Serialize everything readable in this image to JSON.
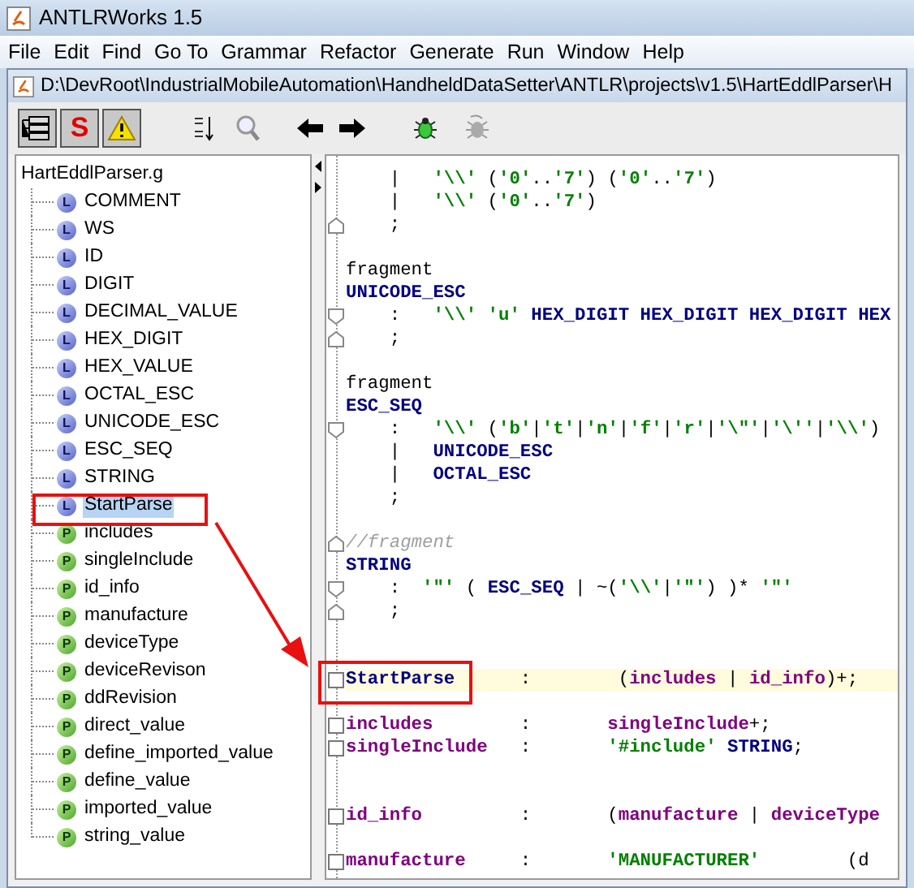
{
  "window": {
    "title": "ANTLRWorks 1.5"
  },
  "menu": [
    "File",
    "Edit",
    "Find",
    "Go To",
    "Grammar",
    "Refactor",
    "Generate",
    "Run",
    "Window",
    "Help"
  ],
  "document": {
    "title": "D:\\DevRoot\\IndustrialMobileAutomation\\HandheldDataSetter\\ANTLR\\projects\\v1.5\\HartEddlParser\\H"
  },
  "toolbar": [
    {
      "kind": "tree"
    },
    {
      "kind": "text",
      "label": "S"
    },
    {
      "kind": "warning"
    },
    {
      "kind": "sort"
    },
    {
      "kind": "find"
    },
    {
      "kind": "back"
    },
    {
      "kind": "forward"
    },
    {
      "kind": "debug"
    },
    {
      "kind": "debug_off"
    }
  ],
  "tree": {
    "root": "HartEddlParser.g",
    "items": [
      {
        "badge": "L",
        "label": "COMMENT",
        "selected": false
      },
      {
        "badge": "L",
        "label": "WS",
        "selected": false
      },
      {
        "badge": "L",
        "label": "ID",
        "selected": false
      },
      {
        "badge": "L",
        "label": "DIGIT",
        "selected": false
      },
      {
        "badge": "L",
        "label": "DECIMAL_VALUE",
        "selected": false
      },
      {
        "badge": "L",
        "label": "HEX_DIGIT",
        "selected": false
      },
      {
        "badge": "L",
        "label": "HEX_VALUE",
        "selected": false
      },
      {
        "badge": "L",
        "label": "OCTAL_ESC",
        "selected": false
      },
      {
        "badge": "L",
        "label": "UNICODE_ESC",
        "selected": false
      },
      {
        "badge": "L",
        "label": "ESC_SEQ",
        "selected": false
      },
      {
        "badge": "L",
        "label": "STRING",
        "selected": false
      },
      {
        "badge": "L",
        "label": "StartParse",
        "selected": true
      },
      {
        "badge": "P",
        "label": "includes",
        "selected": false
      },
      {
        "badge": "P",
        "label": "singleInclude",
        "selected": false
      },
      {
        "badge": "P",
        "label": "id_info",
        "selected": false
      },
      {
        "badge": "P",
        "label": "manufacture",
        "selected": false
      },
      {
        "badge": "P",
        "label": "deviceType",
        "selected": false
      },
      {
        "badge": "P",
        "label": "deviceRevison",
        "selected": false
      },
      {
        "badge": "P",
        "label": "ddRevision",
        "selected": false
      },
      {
        "badge": "P",
        "label": "direct_value",
        "selected": false
      },
      {
        "badge": "P",
        "label": "define_imported_value",
        "selected": false
      },
      {
        "badge": "P",
        "label": "define_value",
        "selected": false
      },
      {
        "badge": "P",
        "label": "imported_value",
        "selected": false
      },
      {
        "badge": "P",
        "label": "string_value",
        "selected": false
      }
    ]
  },
  "editor": {
    "lines": [
      {
        "kind": "line",
        "highlighted": false,
        "parts": [
          {
            "kind": "plain",
            "text": "    |   "
          },
          {
            "kind": "literal",
            "text": "'\\\\'"
          },
          {
            "kind": "plain",
            "text": " ("
          },
          {
            "kind": "literal",
            "text": "'0'"
          },
          {
            "kind": "plain",
            "text": ".."
          },
          {
            "kind": "literal",
            "text": "'7'"
          },
          {
            "kind": "plain",
            "text": ") ("
          },
          {
            "kind": "literal",
            "text": "'0'"
          },
          {
            "kind": "plain",
            "text": ".."
          },
          {
            "kind": "literal",
            "text": "'7'"
          },
          {
            "kind": "plain",
            "text": ")"
          }
        ]
      },
      {
        "kind": "line",
        "highlighted": false,
        "parts": [
          {
            "kind": "plain",
            "text": "    |   "
          },
          {
            "kind": "literal",
            "text": "'\\\\'"
          },
          {
            "kind": "plain",
            "text": " ("
          },
          {
            "kind": "literal",
            "text": "'0'"
          },
          {
            "kind": "plain",
            "text": ".."
          },
          {
            "kind": "literal",
            "text": "'7'"
          },
          {
            "kind": "plain",
            "text": ")"
          }
        ]
      },
      {
        "kind": "fold_close",
        "highlighted": false,
        "parts": [
          {
            "kind": "plain",
            "text": "    ;"
          }
        ]
      },
      {
        "kind": "blank"
      },
      {
        "kind": "line",
        "highlighted": false,
        "parts": [
          {
            "kind": "plain",
            "text": "fragment"
          }
        ]
      },
      {
        "kind": "line",
        "highlighted": false,
        "parts": [
          {
            "kind": "token",
            "text": "UNICODE_ESC"
          }
        ]
      },
      {
        "kind": "fold_open",
        "highlighted": false,
        "parts": [
          {
            "kind": "plain",
            "text": "    :   "
          },
          {
            "kind": "literal",
            "text": "'\\\\' 'u' "
          },
          {
            "kind": "token",
            "text": "HEX_DIGIT HEX_DIGIT HEX_DIGIT HEX"
          }
        ]
      },
      {
        "kind": "fold_close",
        "highlighted": false,
        "parts": [
          {
            "kind": "plain",
            "text": "    ;"
          }
        ]
      },
      {
        "kind": "blank"
      },
      {
        "kind": "line",
        "highlighted": false,
        "parts": [
          {
            "kind": "plain",
            "text": "fragment"
          }
        ]
      },
      {
        "kind": "line",
        "highlighted": false,
        "parts": [
          {
            "kind": "token",
            "text": "ESC_SEQ"
          }
        ]
      },
      {
        "kind": "fold_open",
        "highlighted": false,
        "parts": [
          {
            "kind": "plain",
            "text": "    :   "
          },
          {
            "kind": "literal",
            "text": "'\\\\'"
          },
          {
            "kind": "plain",
            "text": " ("
          },
          {
            "kind": "literal",
            "text": "'b'"
          },
          {
            "kind": "plain",
            "text": "|"
          },
          {
            "kind": "literal",
            "text": "'t'"
          },
          {
            "kind": "plain",
            "text": "|"
          },
          {
            "kind": "literal",
            "text": "'n'"
          },
          {
            "kind": "plain",
            "text": "|"
          },
          {
            "kind": "literal",
            "text": "'f'"
          },
          {
            "kind": "plain",
            "text": "|"
          },
          {
            "kind": "literal",
            "text": "'r'"
          },
          {
            "kind": "plain",
            "text": "|"
          },
          {
            "kind": "literal",
            "text": "'\\\"'"
          },
          {
            "kind": "plain",
            "text": "|"
          },
          {
            "kind": "literal",
            "text": "'\\''"
          },
          {
            "kind": "plain",
            "text": "|"
          },
          {
            "kind": "literal",
            "text": "'\\\\'"
          },
          {
            "kind": "plain",
            "text": ")"
          }
        ]
      },
      {
        "kind": "line",
        "highlighted": false,
        "parts": [
          {
            "kind": "plain",
            "text": "    |   "
          },
          {
            "kind": "token",
            "text": "UNICODE_ESC"
          }
        ]
      },
      {
        "kind": "line",
        "highlighted": false,
        "parts": [
          {
            "kind": "plain",
            "text": "    |   "
          },
          {
            "kind": "token",
            "text": "OCTAL_ESC"
          }
        ]
      },
      {
        "kind": "line",
        "highlighted": false,
        "parts": [
          {
            "kind": "plain",
            "text": "    ;"
          }
        ]
      },
      {
        "kind": "blank"
      },
      {
        "kind": "fold_close",
        "highlighted": false,
        "parts": [
          {
            "kind": "comment",
            "text": "//fragment"
          }
        ]
      },
      {
        "kind": "line",
        "highlighted": false,
        "parts": [
          {
            "kind": "token",
            "text": "STRING"
          }
        ]
      },
      {
        "kind": "fold_open",
        "highlighted": false,
        "parts": [
          {
            "kind": "plain",
            "text": "    :  "
          },
          {
            "kind": "literal",
            "text": "'\"'"
          },
          {
            "kind": "plain",
            "text": " ( "
          },
          {
            "kind": "token",
            "text": "ESC_SEQ"
          },
          {
            "kind": "plain",
            "text": " | ~("
          },
          {
            "kind": "literal",
            "text": "'\\\\'"
          },
          {
            "kind": "plain",
            "text": "|"
          },
          {
            "kind": "literal",
            "text": "'\"'"
          },
          {
            "kind": "plain",
            "text": ") )* "
          },
          {
            "kind": "literal",
            "text": "'\"'"
          }
        ]
      },
      {
        "kind": "fold_close",
        "highlighted": false,
        "parts": [
          {
            "kind": "plain",
            "text": "    ;"
          }
        ]
      },
      {
        "kind": "blank"
      },
      {
        "kind": "blank"
      },
      {
        "kind": "rule_box",
        "highlighted": true,
        "parts": [
          {
            "kind": "token",
            "text": "StartParse"
          },
          {
            "kind": "plain",
            "text": "      :        ("
          },
          {
            "kind": "rule",
            "text": "includes"
          },
          {
            "kind": "plain",
            "text": " | "
          },
          {
            "kind": "rule",
            "text": "id_info"
          },
          {
            "kind": "plain",
            "text": ")+;"
          }
        ]
      },
      {
        "kind": "blank"
      },
      {
        "kind": "rule_box",
        "highlighted": false,
        "parts": [
          {
            "kind": "rule",
            "text": "includes"
          },
          {
            "kind": "plain",
            "text": "        :       "
          },
          {
            "kind": "rule",
            "text": "singleInclude"
          },
          {
            "kind": "plain",
            "text": "+;"
          }
        ]
      },
      {
        "kind": "rule_box",
        "highlighted": false,
        "parts": [
          {
            "kind": "rule",
            "text": "singleInclude"
          },
          {
            "kind": "plain",
            "text": "   :       "
          },
          {
            "kind": "literal",
            "text": "'#include' "
          },
          {
            "kind": "token",
            "text": "STRING"
          },
          {
            "kind": "plain",
            "text": ";"
          }
        ]
      },
      {
        "kind": "blank"
      },
      {
        "kind": "blank"
      },
      {
        "kind": "rule_box",
        "highlighted": false,
        "parts": [
          {
            "kind": "rule",
            "text": "id_info"
          },
          {
            "kind": "plain",
            "text": "         :       ("
          },
          {
            "kind": "rule",
            "text": "manufacture"
          },
          {
            "kind": "plain",
            "text": " | "
          },
          {
            "kind": "rule",
            "text": "deviceType"
          }
        ]
      },
      {
        "kind": "blank"
      },
      {
        "kind": "rule_box",
        "highlighted": false,
        "parts": [
          {
            "kind": "rule",
            "text": "manufacture"
          },
          {
            "kind": "plain",
            "text": "     :       "
          },
          {
            "kind": "literal",
            "text": "'MANUFACTURER'"
          },
          {
            "kind": "plain",
            "text": "        (d"
          }
        ]
      }
    ]
  }
}
